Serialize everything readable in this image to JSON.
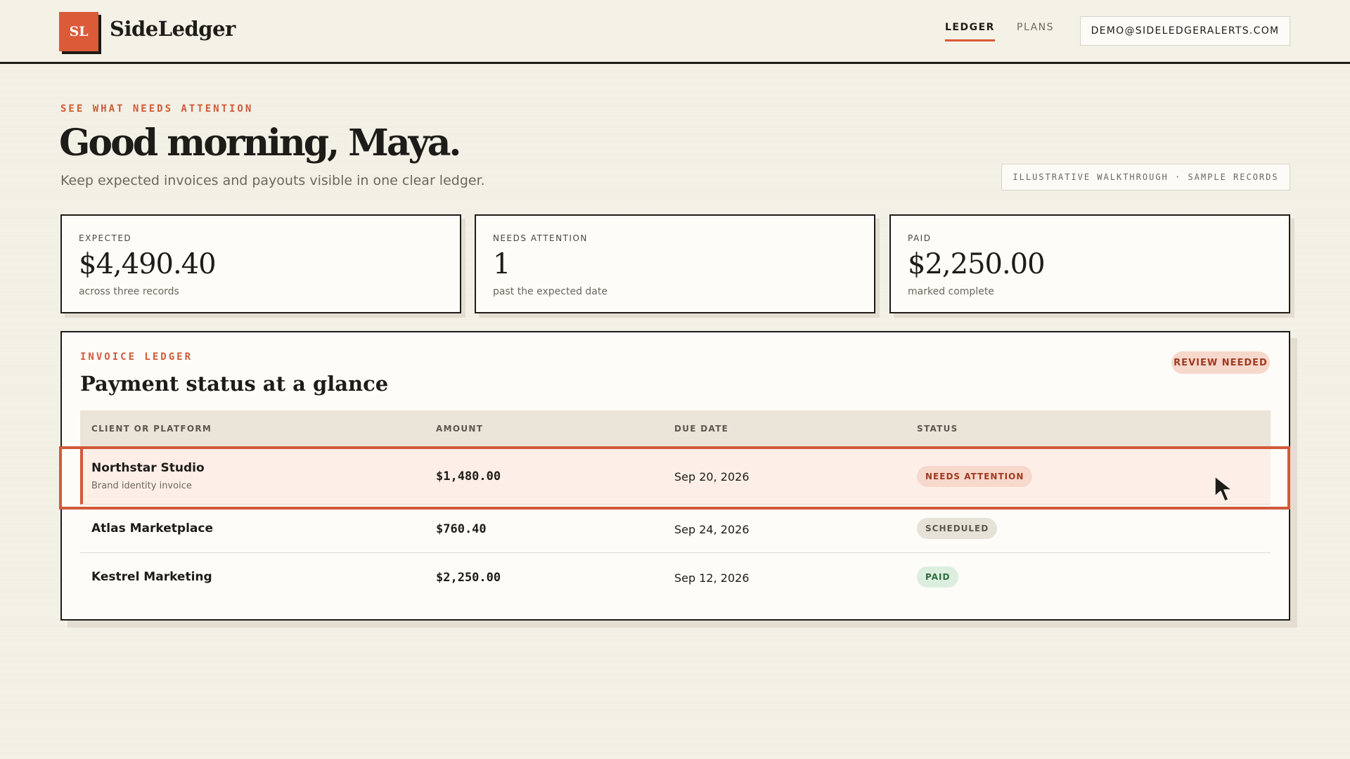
{
  "header": {
    "logo_mark": "SL",
    "app_name": "SideLedger",
    "nav": [
      {
        "label": "LEDGER",
        "active": true
      },
      {
        "label": "PLANS",
        "active": false
      }
    ],
    "account_email": "DEMO@SIDELEDGERALERTS.COM"
  },
  "intro": {
    "eyebrow": "SEE WHAT NEEDS ATTENTION",
    "greeting": "Good morning, Maya.",
    "subtitle": "Keep expected invoices and payouts visible in one clear ledger.",
    "walkthrough_badge": "ILLUSTRATIVE WALKTHROUGH · SAMPLE RECORDS"
  },
  "summary_cards": [
    {
      "label": "EXPECTED",
      "value": "$4,490.40",
      "note": "across three records"
    },
    {
      "label": "NEEDS ATTENTION",
      "value": "1",
      "note": "past the expected date"
    },
    {
      "label": "PAID",
      "value": "$2,250.00",
      "note": "marked complete"
    }
  ],
  "ledger": {
    "eyebrow": "INVOICE LEDGER",
    "title": "Payment status at a glance",
    "review_badge": "REVIEW NEEDED",
    "columns": [
      "CLIENT OR PLATFORM",
      "AMOUNT",
      "DUE DATE",
      "STATUS"
    ],
    "rows": [
      {
        "client": "Northstar Studio",
        "detail": "Brand identity invoice",
        "amount": "$1,480.00",
        "due": "Sep 20, 2026",
        "status": "NEEDS ATTENTION",
        "status_kind": "attention"
      },
      {
        "client": "Atlas Marketplace",
        "detail": "",
        "amount": "$760.40",
        "due": "Sep 24, 2026",
        "status": "SCHEDULED",
        "status_kind": "scheduled"
      },
      {
        "client": "Kestrel Marketing",
        "detail": "",
        "amount": "$2,250.00",
        "due": "Sep 12, 2026",
        "status": "PAID",
        "status_kind": "paid"
      }
    ]
  },
  "colors": {
    "accent": "#db5a37",
    "background": "#f3f0e6",
    "ink": "#1e1c18",
    "attention_pill": "#f7d8cc",
    "paid_pill": "#dcefdf"
  }
}
